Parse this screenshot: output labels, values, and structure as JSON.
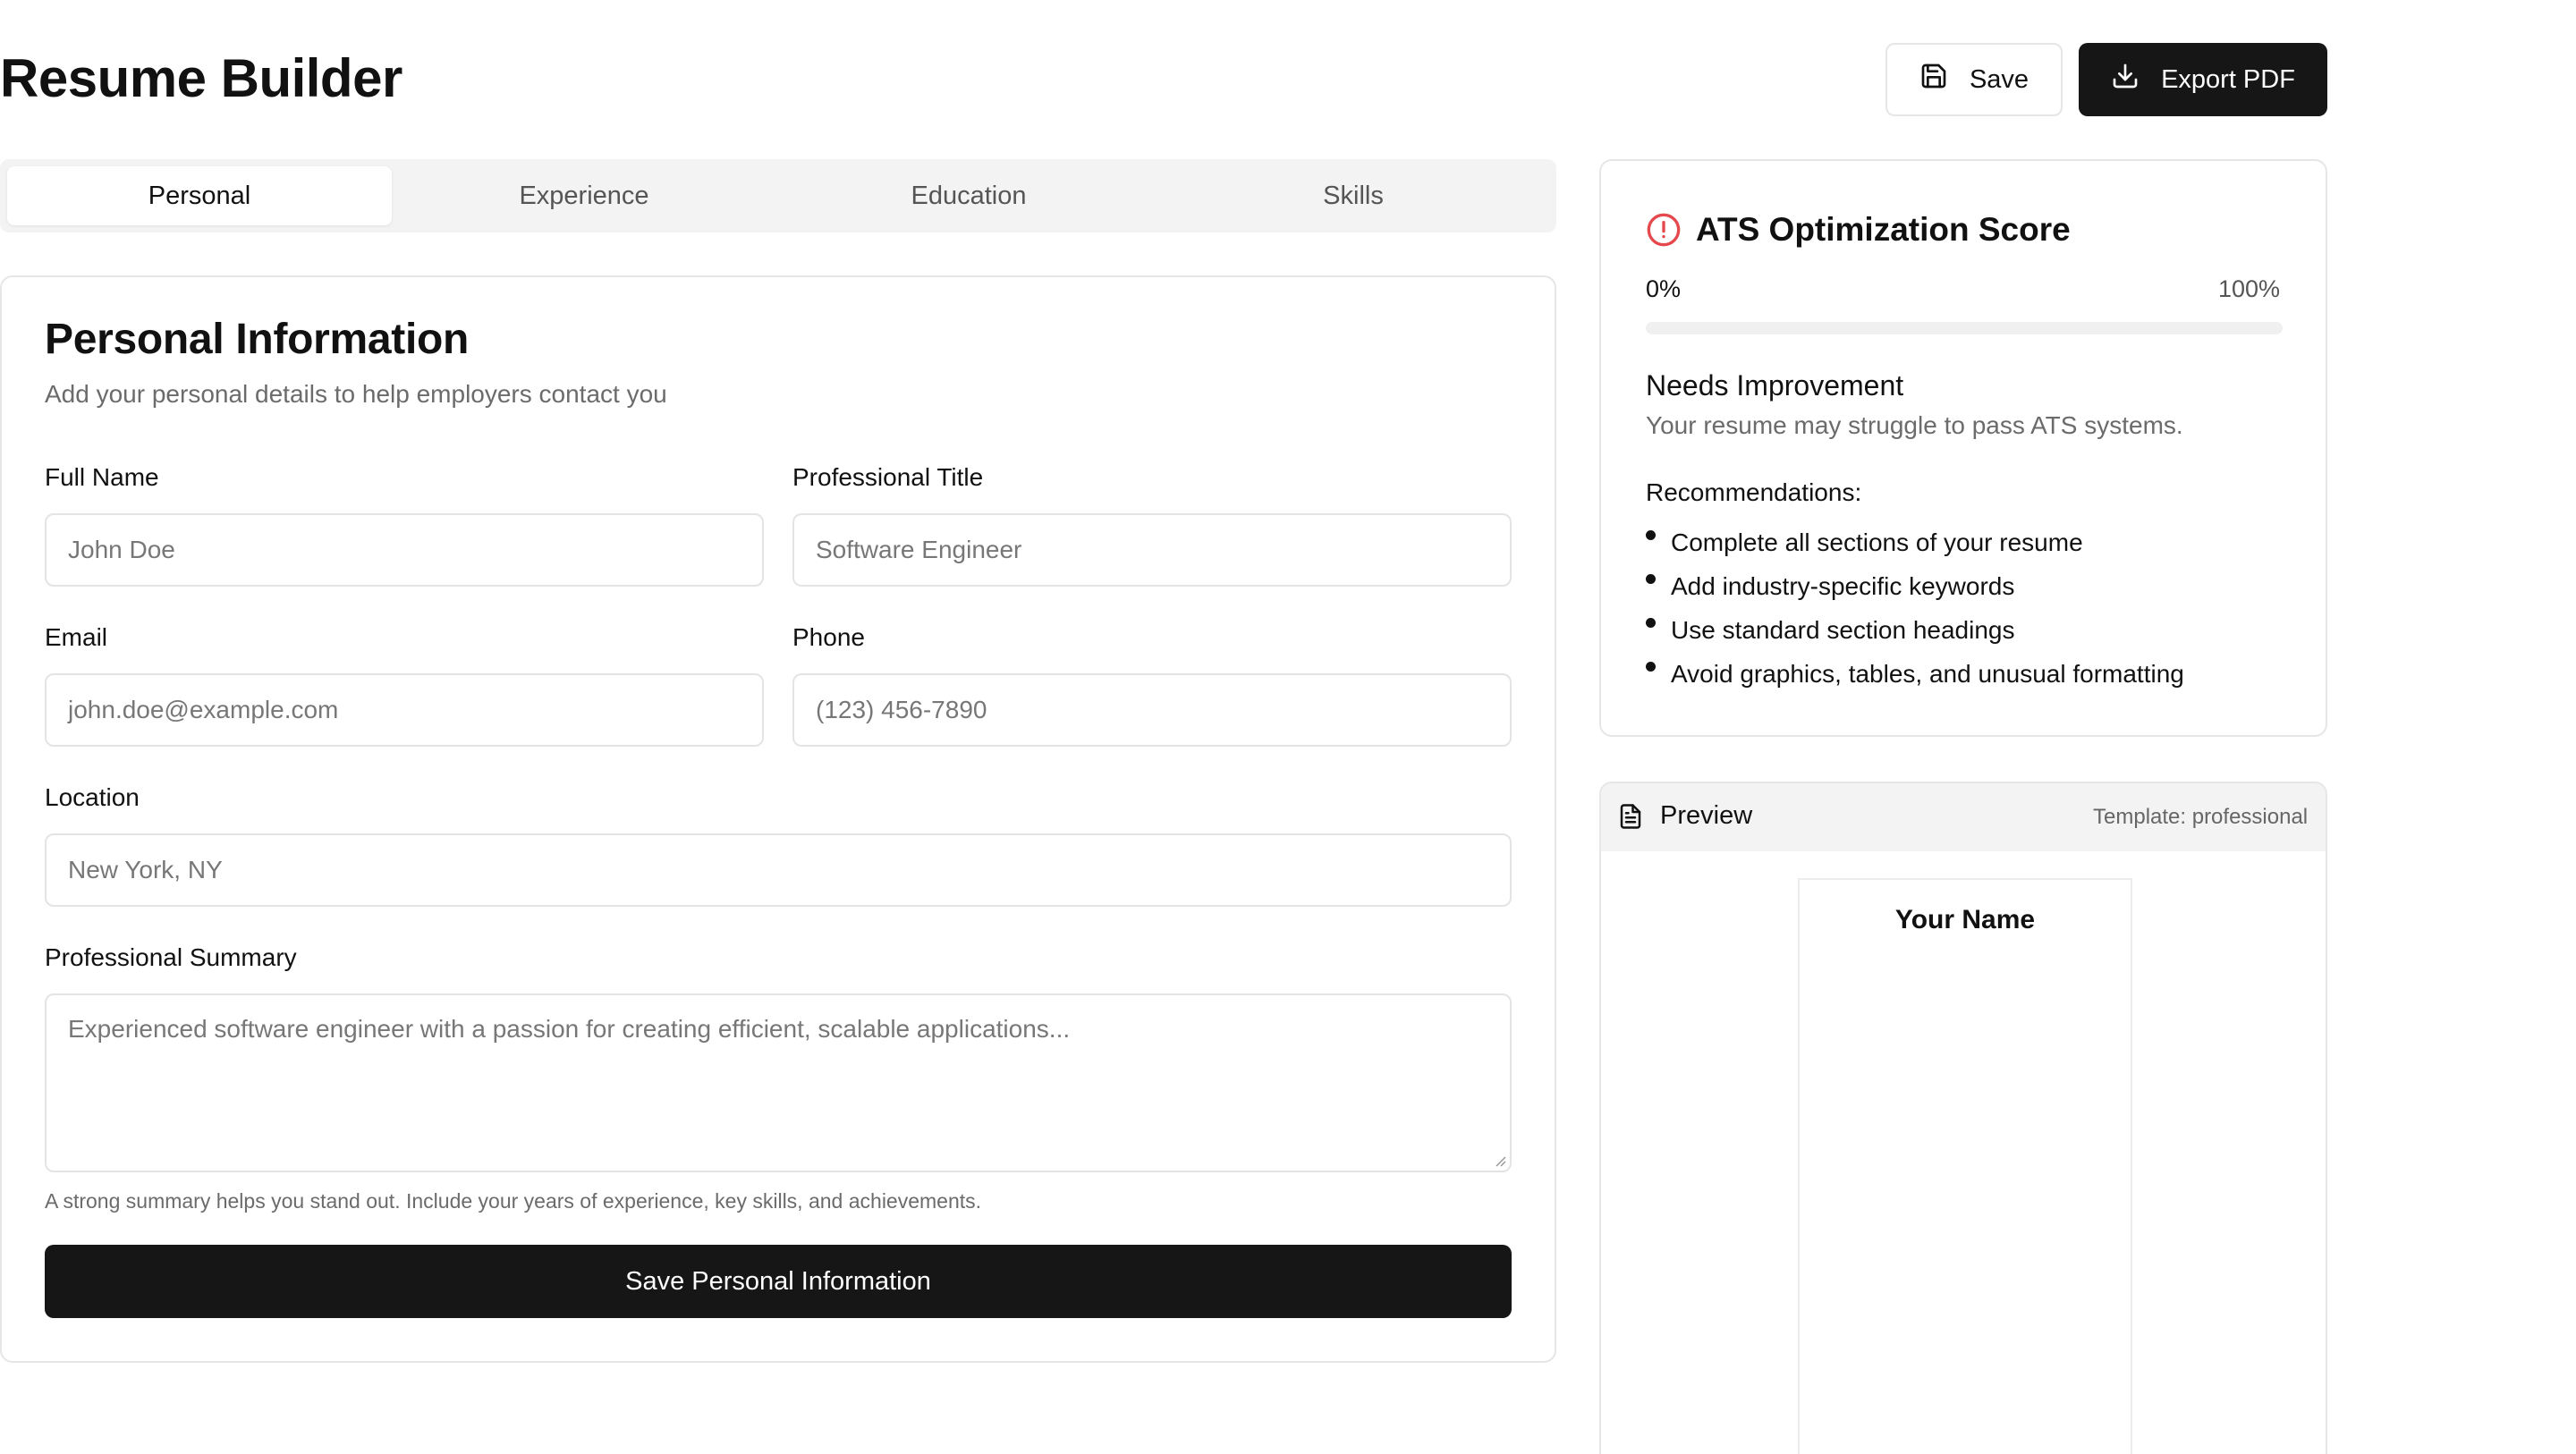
{
  "header": {
    "title": "Resume Builder",
    "save_label": "Save",
    "export_label": "Export PDF"
  },
  "tabs": [
    {
      "label": "Personal",
      "active": true
    },
    {
      "label": "Experience",
      "active": false
    },
    {
      "label": "Education",
      "active": false
    },
    {
      "label": "Skills",
      "active": false
    }
  ],
  "form": {
    "title": "Personal Information",
    "subtitle": "Add your personal details to help employers contact you",
    "full_name": {
      "label": "Full Name",
      "placeholder": "John Doe"
    },
    "professional_title": {
      "label": "Professional Title",
      "placeholder": "Software Engineer"
    },
    "email": {
      "label": "Email",
      "placeholder": "john.doe@example.com"
    },
    "phone": {
      "label": "Phone",
      "placeholder": "(123) 456-7890"
    },
    "location": {
      "label": "Location",
      "placeholder": "New York, NY"
    },
    "summary": {
      "label": "Professional Summary",
      "placeholder": "Experienced software engineer with a passion for creating efficient, scalable applications...",
      "help": "A strong summary helps you stand out. Include your years of experience, key skills, and achievements."
    },
    "submit_label": "Save Personal Information"
  },
  "ats": {
    "title": "ATS Optimization Score",
    "min_label": "0%",
    "max_label": "100%",
    "score_percent": 0,
    "status": "Needs Improvement",
    "status_detail": "Your resume may struggle to pass ATS systems.",
    "recommendations_label": "Recommendations:",
    "recommendations": [
      "Complete all sections of your resume",
      "Add industry-specific keywords",
      "Use standard section headings",
      "Avoid graphics, tables, and unusual formatting"
    ],
    "alert_color": "#e5484d"
  },
  "preview": {
    "label": "Preview",
    "template": "Template: professional",
    "name": "Your Name"
  }
}
